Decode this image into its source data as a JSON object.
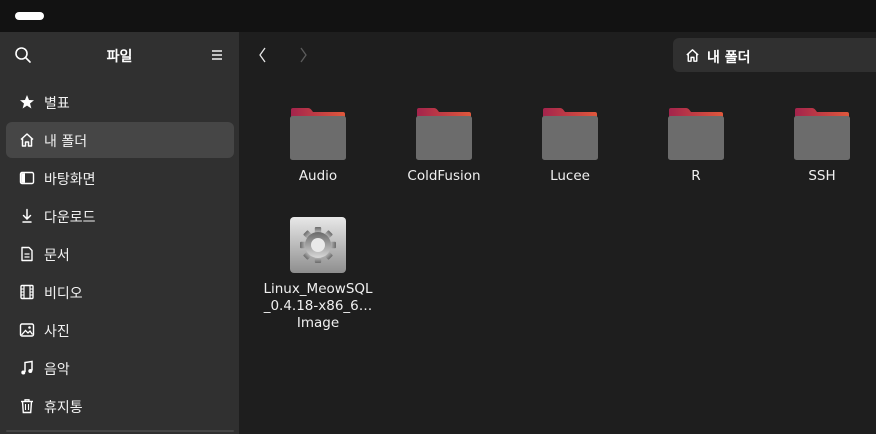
{
  "sidebar": {
    "title": "파일",
    "items": [
      {
        "label": "별표",
        "icon": "star-icon",
        "active": false
      },
      {
        "label": "내 폴더",
        "icon": "home-icon",
        "active": true
      },
      {
        "label": "바탕화면",
        "icon": "desktop-icon",
        "active": false
      },
      {
        "label": "다운로드",
        "icon": "download-icon",
        "active": false
      },
      {
        "label": "문서",
        "icon": "document-icon",
        "active": false
      },
      {
        "label": "비디오",
        "icon": "film-icon",
        "active": false
      },
      {
        "label": "사진",
        "icon": "image-icon",
        "active": false
      },
      {
        "label": "음악",
        "icon": "music-icon",
        "active": false
      },
      {
        "label": "휴지통",
        "icon": "trash-icon",
        "active": false
      }
    ]
  },
  "toolbar": {
    "path": "내 폴더"
  },
  "files": [
    {
      "name": "Audio",
      "type": "folder"
    },
    {
      "name": "ColdFusion",
      "type": "folder"
    },
    {
      "name": "Lucee",
      "type": "folder"
    },
    {
      "name": "R",
      "type": "folder"
    },
    {
      "name": "SSH",
      "type": "folder"
    },
    {
      "name": "Linux_MeowSQL_0.4.18-x86_6… Image",
      "type": "executable"
    }
  ],
  "colors": {
    "sidebar_bg": "#303030",
    "main_bg": "#1e1e1e",
    "folder_tab": "#c7344f",
    "folder_body": "#6c6c6c",
    "active_item_bg": "#464646"
  }
}
